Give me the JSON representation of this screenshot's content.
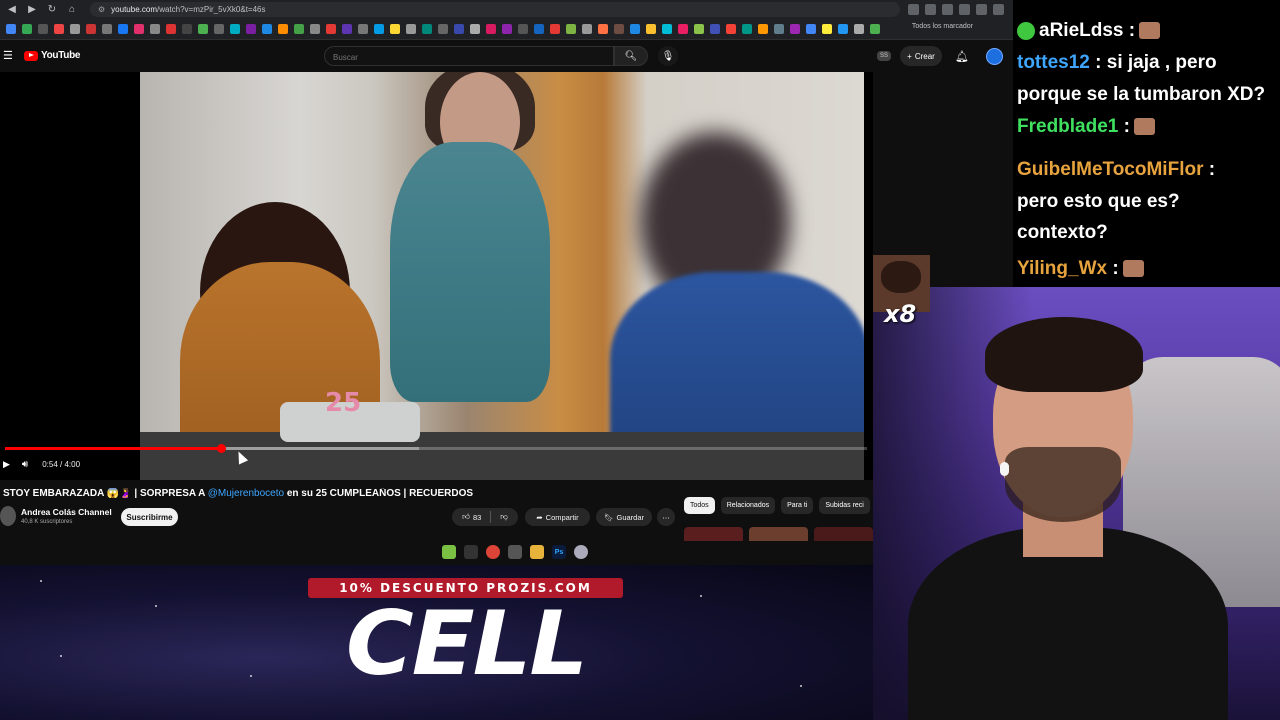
{
  "browser": {
    "url_host": "youtube.com",
    "url_path": "/watch?v=mzPir_5vXk0&t=46s",
    "bookmarks_all_label": "Todos los marcador"
  },
  "youtube": {
    "logo_text": "YouTube",
    "search_placeholder": "Buscar",
    "ss_badge": "SS",
    "create_label": "Crear"
  },
  "player": {
    "time_display": "0:54 / 4:00",
    "progress_fraction": 0.25,
    "candle_number": "25"
  },
  "video": {
    "title_prefix": "STOY EMBARAZADA 😱🤰 | SORPRESA A ",
    "title_mention": "@Mujerenboceto",
    "title_suffix": " en su 25 CUMPLEAÑOS | RECUERDOS",
    "channel_name": "Andrea Colás Channel",
    "channel_subs": "40,8 K suscriptores",
    "subscribe_label": "Suscribirme",
    "like_count": "83",
    "share_label": "Compartir",
    "save_label": "Guardar"
  },
  "chips": [
    "Todos",
    "Relacionados",
    "Para ti",
    "Subidas reci"
  ],
  "promo": {
    "banner": "10% DESCUENTO PROZIS.COM",
    "brand": "CELL"
  },
  "chat": {
    "lines": [
      {
        "user": "aRieLdss",
        "msg": ":",
        "color": "#ffffff",
        "emote": true,
        "badge": true
      },
      {
        "user": "tottes12",
        "msg": ": si jaja , pero",
        "color": "#3ea6ff",
        "emote": false,
        "badge": false
      },
      {
        "user": "",
        "msg": "porque se la tumbaron XD?",
        "color": "#ffffff",
        "emote": false,
        "badge": false
      },
      {
        "user": "Fredblade1",
        "msg": ":",
        "color": "#3fe060",
        "emote": true,
        "badge": false
      },
      {
        "user": "GuibelMeTocoMiFlor",
        "msg": ":",
        "color": "#e7a33e",
        "emote": false,
        "badge": false
      },
      {
        "user": "",
        "msg": "pero esto que es?",
        "color": "#ffffff",
        "emote": false,
        "badge": false
      },
      {
        "user": "",
        "msg": "contexto?",
        "color": "#ffffff",
        "emote": false,
        "badge": false
      },
      {
        "user": "Yiling_Wx",
        "msg": ":",
        "color": "#e7a33e",
        "emote": true,
        "badge": false
      }
    ],
    "emote_combo": "x8"
  },
  "colors": {
    "accent": "#ff0000",
    "promo_red": "#b01a2a",
    "link_blue": "#3ea6ff"
  },
  "icons": [
    "hamburger-icon",
    "search-icon",
    "mic-icon",
    "bell-icon",
    "play-icon",
    "volume-icon",
    "like-icon",
    "dislike-icon",
    "share-icon",
    "bookmark-icon",
    "more-icon"
  ]
}
